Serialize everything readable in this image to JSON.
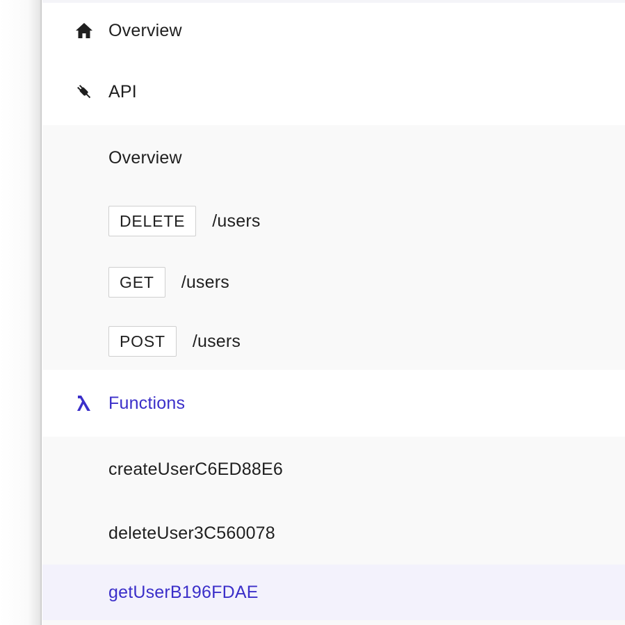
{
  "nav": {
    "overview_label": "Overview",
    "api_label": "API",
    "api_children": {
      "overview_label": "Overview",
      "routes": [
        {
          "method": "DELETE",
          "path": "/users"
        },
        {
          "method": "GET",
          "path": "/users"
        },
        {
          "method": "POST",
          "path": "/users"
        }
      ]
    },
    "functions_label": "Functions",
    "functions": [
      {
        "name": "createUserC6ED88E6",
        "active": false
      },
      {
        "name": "deleteUser3C560078",
        "active": false
      },
      {
        "name": "getUserB196FDAE",
        "active": true
      }
    ]
  },
  "icons": {
    "overview": "home-icon",
    "api": "plug-icon",
    "functions": "lambda-icon"
  },
  "colors": {
    "accent": "#3b2fc9",
    "active_bg": "#f3f2fc",
    "sub_bg": "#f9f9f9"
  }
}
